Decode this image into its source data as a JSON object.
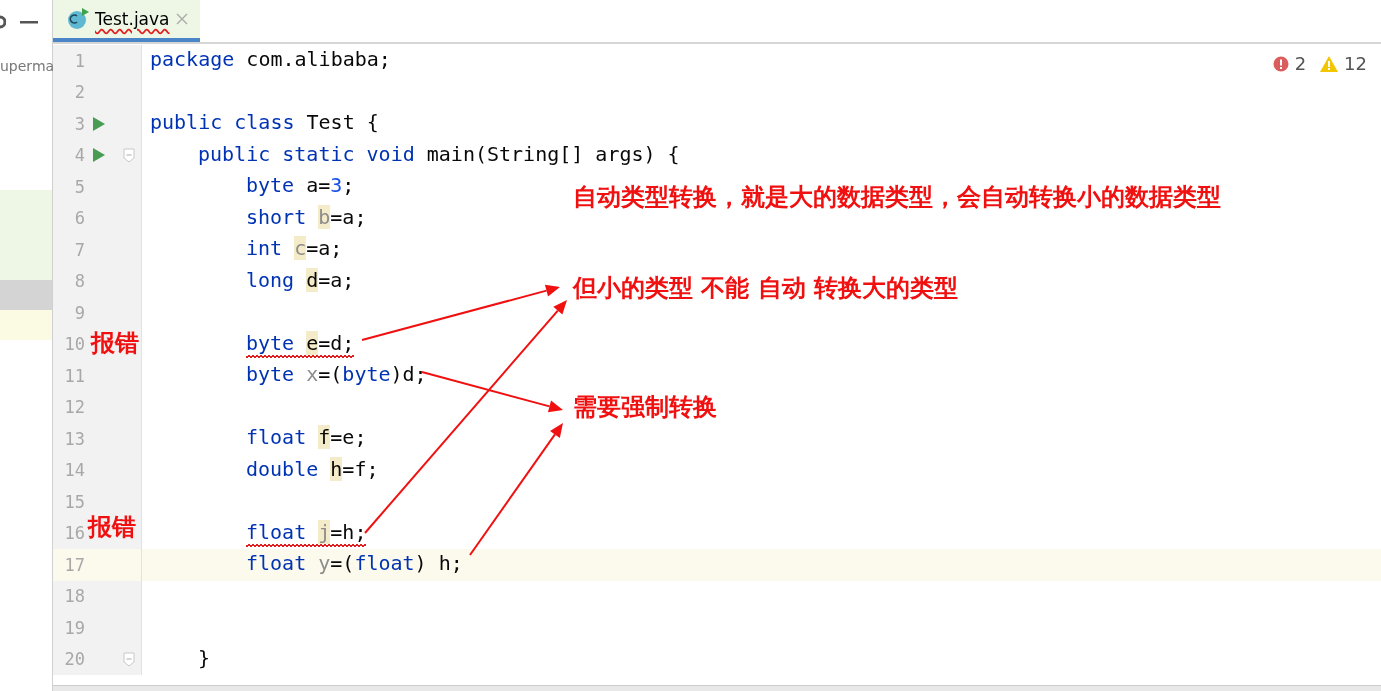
{
  "sidebar": {
    "label": "uperma"
  },
  "tabs": [
    {
      "label": "Test.java",
      "selected": true,
      "error": true
    }
  ],
  "inspections": {
    "errors": "2",
    "warnings": "12"
  },
  "lines": [
    {
      "number": "1",
      "run": false,
      "fold": false,
      "error": false,
      "current": false,
      "tokens": [
        {
          "text": "package",
          "kind": "keyword"
        },
        {
          "text": " com.alibaba;",
          "kind": "plain"
        }
      ]
    },
    {
      "number": "2",
      "run": false,
      "fold": false,
      "error": false,
      "current": false
    },
    {
      "number": "3",
      "run": true,
      "fold": false,
      "error": false,
      "current": false,
      "tokens": [
        {
          "text": "public class",
          "kind": "keyword"
        },
        {
          "text": " Test {",
          "kind": "plain"
        }
      ],
      "children": [
        {
          "number": "4",
          "run": true,
          "fold": true,
          "error": false,
          "current": false,
          "tokens": [
            {
              "text": "public static void",
              "kind": "keyword"
            },
            {
              "text": " main(String[] args) {",
              "kind": "plain"
            }
          ],
          "children": [
            {
              "number": "5",
              "run": false,
              "fold": false,
              "error": false,
              "current": false,
              "tokens": [
                {
                  "text": "byte",
                  "kind": "keyword"
                },
                {
                  "text": " a=",
                  "kind": "plain"
                },
                {
                  "text": "3",
                  "kind": "number"
                },
                {
                  "text": ";",
                  "kind": "plain"
                }
              ]
            },
            {
              "number": "6",
              "run": false,
              "fold": false,
              "error": false,
              "current": false,
              "tokens": [
                {
                  "text": "short ",
                  "kind": "keyword"
                },
                {
                  "text": "b",
                  "kind": "unused-marked"
                },
                {
                  "text": "=a;",
                  "kind": "plain"
                }
              ]
            },
            {
              "number": "7",
              "run": false,
              "fold": false,
              "error": false,
              "current": false,
              "tokens": [
                {
                  "text": "int ",
                  "kind": "keyword"
                },
                {
                  "text": "c",
                  "kind": "unused-marked"
                },
                {
                  "text": "=a;",
                  "kind": "plain"
                }
              ]
            },
            {
              "number": "8",
              "run": false,
              "fold": false,
              "error": false,
              "current": false,
              "tokens": [
                {
                  "text": "long ",
                  "kind": "keyword"
                },
                {
                  "text": "d",
                  "kind": "marked"
                },
                {
                  "text": "=a;",
                  "kind": "plain"
                }
              ]
            },
            {
              "number": "9",
              "run": false,
              "fold": false,
              "error": false,
              "current": false
            },
            {
              "number": "10",
              "run": false,
              "fold": false,
              "error": true,
              "current": false,
              "tokens": [
                {
                  "text": "byte ",
                  "kind": "keyword"
                },
                {
                  "text": "e",
                  "kind": "marked"
                },
                {
                  "text": "=d;",
                  "kind": "plain"
                }
              ]
            },
            {
              "number": "11",
              "run": false,
              "fold": false,
              "error": false,
              "current": false,
              "tokens": [
                {
                  "text": "byte ",
                  "kind": "keyword"
                },
                {
                  "text": "x",
                  "kind": "unused"
                },
                {
                  "text": "=(",
                  "kind": "plain"
                },
                {
                  "text": "byte",
                  "kind": "keyword"
                },
                {
                  "text": ")d;",
                  "kind": "plain"
                }
              ]
            },
            {
              "number": "12",
              "run": false,
              "fold": false,
              "error": false,
              "current": false
            },
            {
              "number": "13",
              "run": false,
              "fold": false,
              "error": false,
              "current": false,
              "tokens": [
                {
                  "text": "float ",
                  "kind": "keyword"
                },
                {
                  "text": "f",
                  "kind": "marked"
                },
                {
                  "text": "=e;",
                  "kind": "plain"
                }
              ]
            },
            {
              "number": "14",
              "run": false,
              "fold": false,
              "error": false,
              "current": false,
              "tokens": [
                {
                  "text": "double ",
                  "kind": "keyword"
                },
                {
                  "text": "h",
                  "kind": "marked"
                },
                {
                  "text": "=f;",
                  "kind": "plain"
                }
              ]
            },
            {
              "number": "15",
              "run": false,
              "fold": false,
              "error": false,
              "current": false
            },
            {
              "number": "16",
              "run": false,
              "fold": false,
              "error": true,
              "current": false,
              "tokens": [
                {
                  "text": "float ",
                  "kind": "keyword"
                },
                {
                  "text": "j",
                  "kind": "unused-marked"
                },
                {
                  "text": "=h;",
                  "kind": "plain"
                }
              ]
            },
            {
              "number": "17",
              "run": false,
              "fold": false,
              "error": false,
              "current": true,
              "tokens": [
                {
                  "text": "float ",
                  "kind": "keyword"
                },
                {
                  "text": "y",
                  "kind": "unused"
                },
                {
                  "text": "=(",
                  "kind": "plain"
                },
                {
                  "text": "float",
                  "kind": "keyword"
                },
                {
                  "text": ") h;",
                  "kind": "plain"
                }
              ]
            },
            {
              "number": "18",
              "run": false,
              "fold": false,
              "error": false,
              "current": false
            },
            {
              "number": "19",
              "run": false,
              "fold": false,
              "error": false,
              "current": false
            }
          ]
        },
        {
          "number": "20",
          "run": false,
          "fold": true,
          "error": false,
          "current": false,
          "tokens": [
            {
              "text": "}",
              "kind": "plain"
            }
          ]
        }
      ]
    }
  ],
  "annotations": [
    {
      "text": "自动类型转换，就是大的数据类型，会自动转换小的数据类型"
    },
    {
      "text": "但小的类型  不能  自动  转换大的类型"
    },
    {
      "text": "需要强制转换"
    },
    {
      "text": "报错"
    },
    {
      "text": "报错"
    }
  ]
}
